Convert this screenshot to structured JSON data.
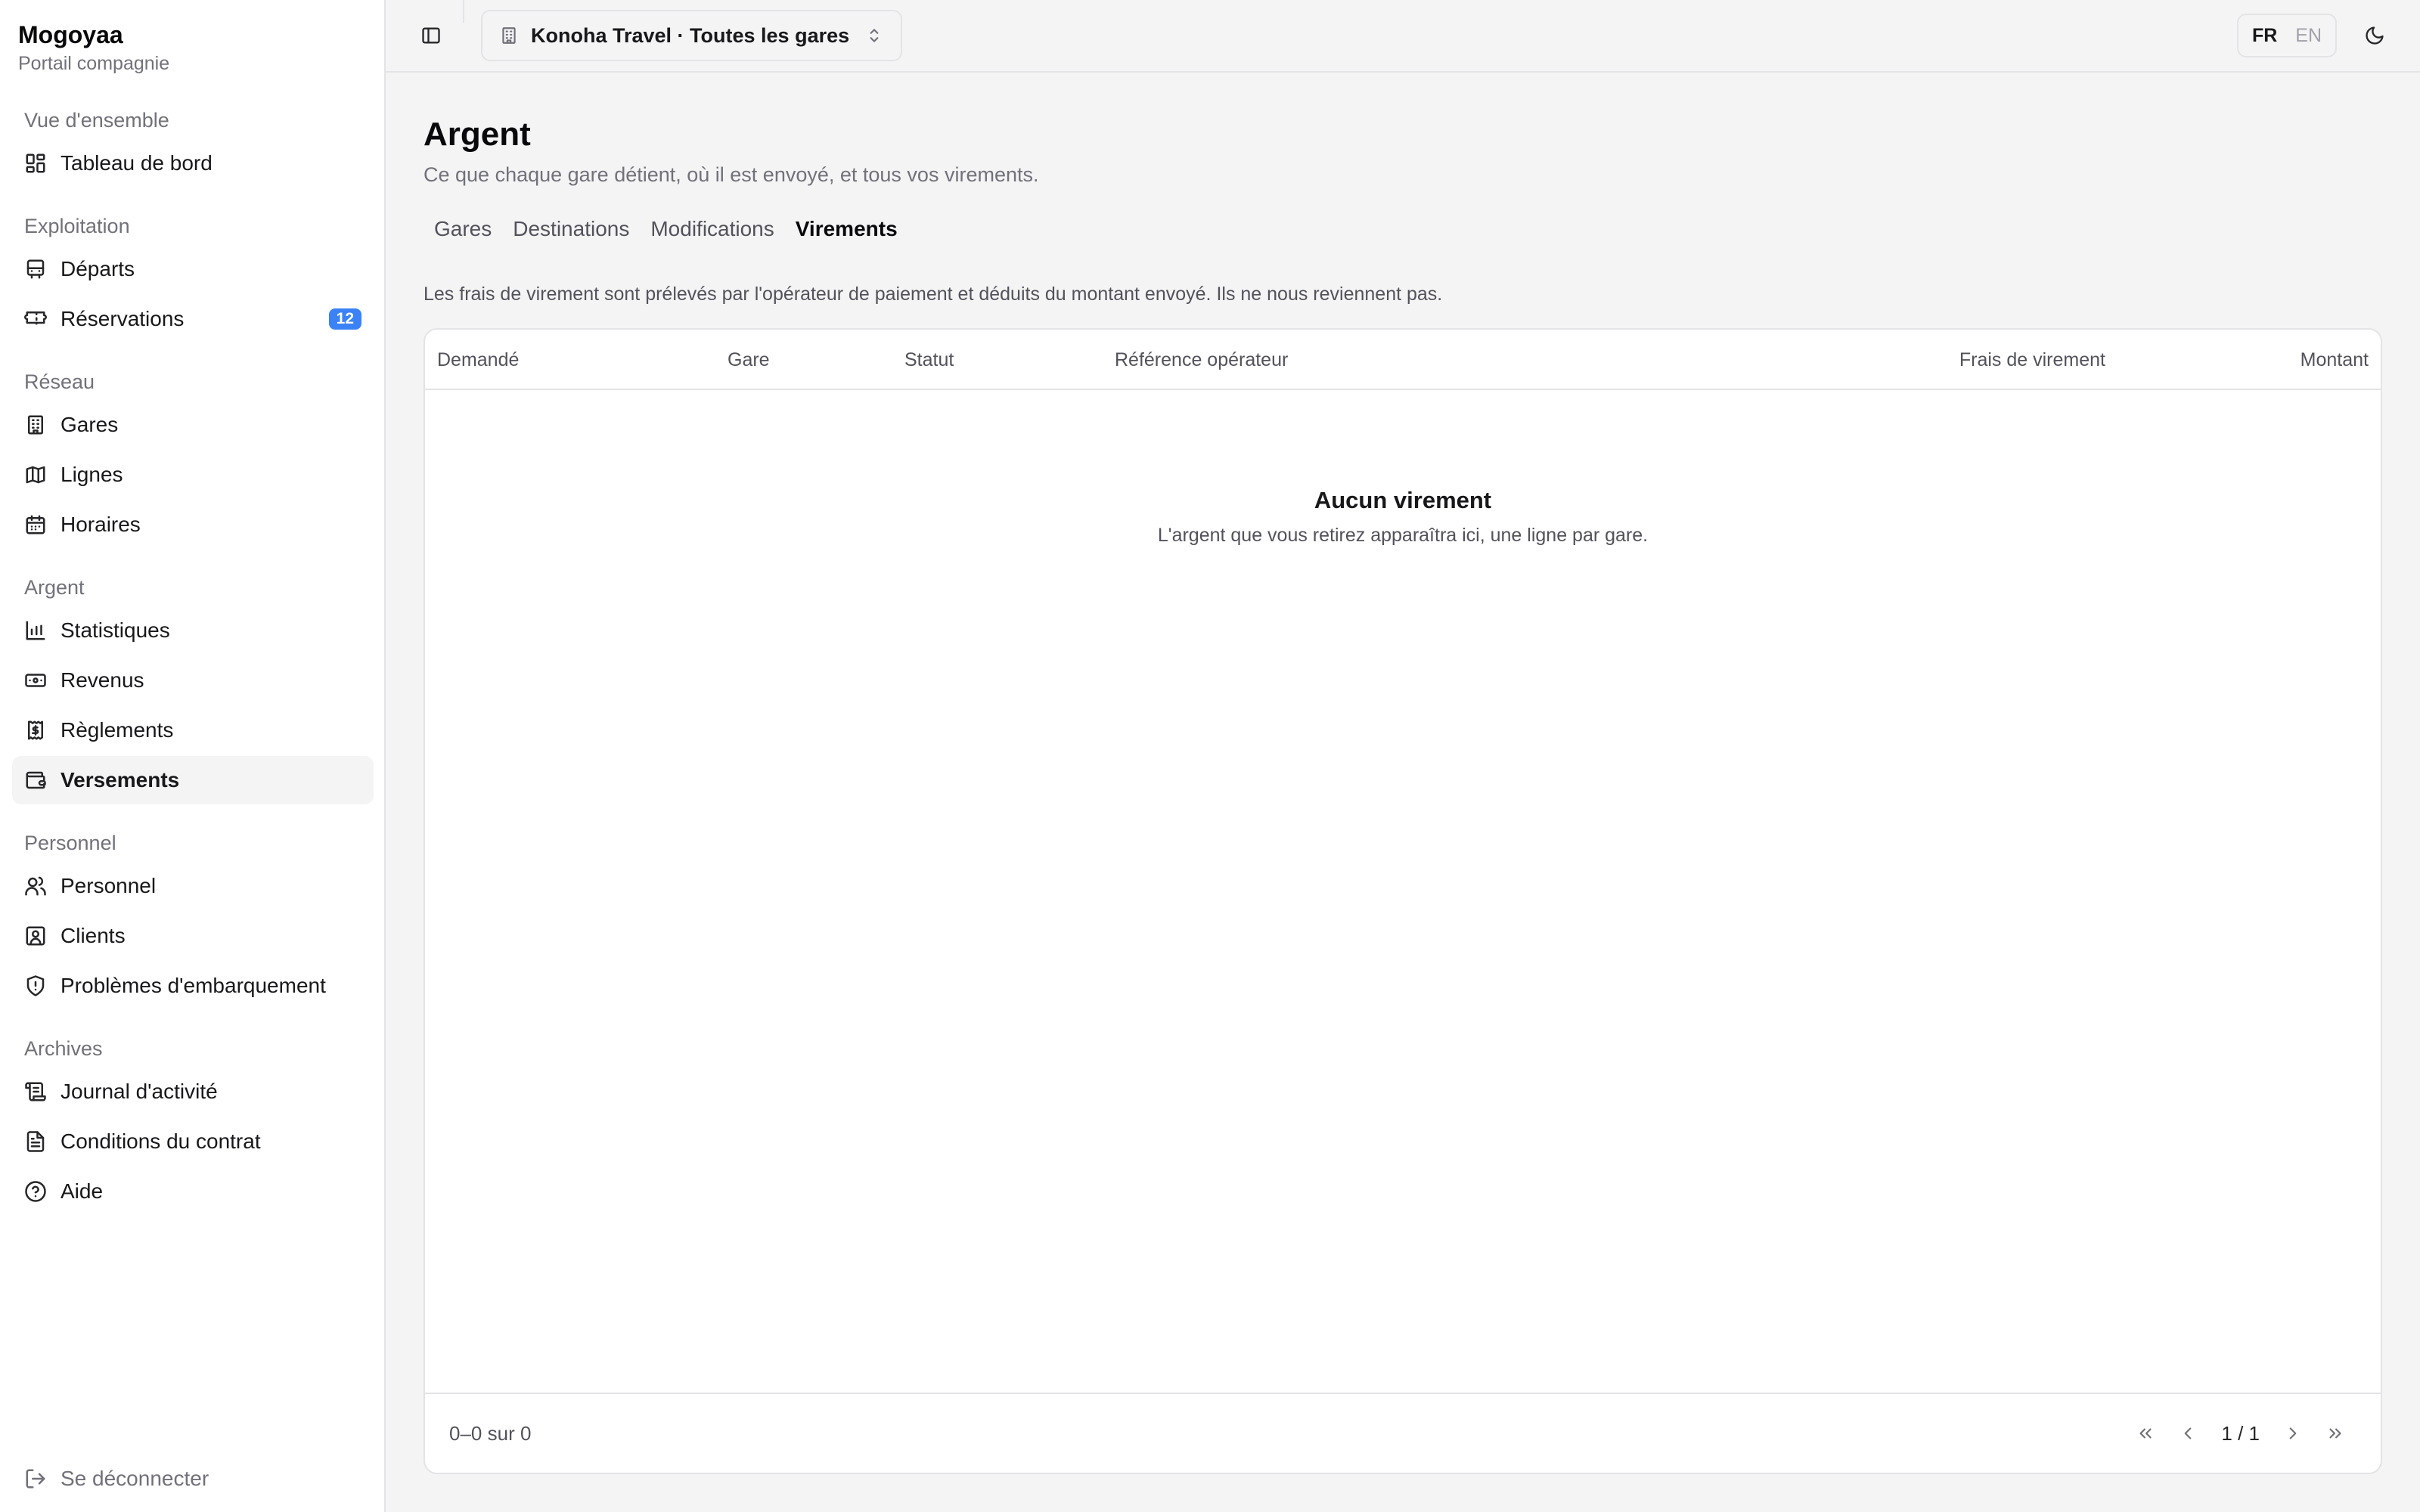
{
  "brand": {
    "name": "Mogoyaa",
    "subtitle": "Portail compagnie"
  },
  "sidebar": {
    "groups": [
      {
        "label": "Vue d'ensemble",
        "items": [
          {
            "label": "Tableau de bord",
            "icon": "dashboard-icon"
          }
        ]
      },
      {
        "label": "Exploitation",
        "items": [
          {
            "label": "Départs",
            "icon": "bus-icon"
          },
          {
            "label": "Réservations",
            "icon": "ticket-icon",
            "badge": "12"
          }
        ]
      },
      {
        "label": "Réseau",
        "items": [
          {
            "label": "Gares",
            "icon": "building-icon"
          },
          {
            "label": "Lignes",
            "icon": "map-icon"
          },
          {
            "label": "Horaires",
            "icon": "calendar-icon"
          }
        ]
      },
      {
        "label": "Argent",
        "items": [
          {
            "label": "Statistiques",
            "icon": "bar-chart-icon"
          },
          {
            "label": "Revenus",
            "icon": "banknote-icon"
          },
          {
            "label": "Règlements",
            "icon": "receipt-icon"
          },
          {
            "label": "Versements",
            "icon": "wallet-icon",
            "active": true
          }
        ]
      },
      {
        "label": "Personnel",
        "items": [
          {
            "label": "Personnel",
            "icon": "users-icon"
          },
          {
            "label": "Clients",
            "icon": "contact-icon"
          },
          {
            "label": "Problèmes d'embarquement",
            "icon": "shield-alert-icon"
          }
        ]
      },
      {
        "label": "Archives",
        "items": [
          {
            "label": "Journal d'activité",
            "icon": "scroll-icon"
          },
          {
            "label": "Conditions du contrat",
            "icon": "document-icon"
          },
          {
            "label": "Aide",
            "icon": "help-circle-icon"
          }
        ]
      }
    ],
    "logout_label": "Se déconnecter"
  },
  "topbar": {
    "org_selector": "Konoha Travel · Toutes les gares",
    "lang_active": "FR",
    "lang_inactive": "EN"
  },
  "page": {
    "title": "Argent",
    "subtitle": "Ce que chaque gare détient, où il est envoyé, et tous vos virements.",
    "tabs": [
      {
        "label": "Gares"
      },
      {
        "label": "Destinations"
      },
      {
        "label": "Modifications"
      },
      {
        "label": "Virements",
        "active": true
      }
    ],
    "note": "Les frais de virement sont prélevés par l'opérateur de paiement et déduits du montant envoyé. Ils ne nous reviennent pas."
  },
  "table": {
    "columns": [
      "Demandé",
      "Gare",
      "Statut",
      "Référence opérateur",
      "Frais de virement",
      "Montant"
    ],
    "rows": [],
    "empty_title": "Aucun virement",
    "empty_subtitle": "L'argent que vous retirez apparaîtra ici, une ligne par gare.",
    "range_text": "0–0 sur 0",
    "page_text": "1 / 1"
  },
  "colors": {
    "accent": "#3b82f6",
    "border": "#e4e4e7",
    "muted_text": "#71717a"
  }
}
